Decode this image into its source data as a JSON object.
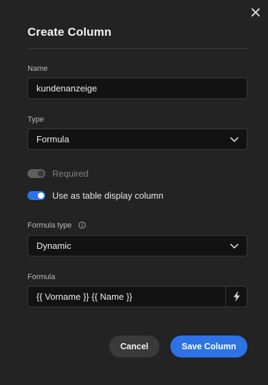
{
  "dialog": {
    "title": "Create Column"
  },
  "name_field": {
    "label": "Name",
    "value": "kundenanzeige"
  },
  "type_field": {
    "label": "Type",
    "value": "Formula"
  },
  "toggles": {
    "required": {
      "label": "Required",
      "on": false
    },
    "display_column": {
      "label": "Use as table display column",
      "on": true
    }
  },
  "formula_type_field": {
    "label": "Formula type",
    "value": "Dynamic"
  },
  "formula_field": {
    "label": "Formula",
    "value": "{{ Vorname }} {{ Name }}"
  },
  "actions": {
    "cancel_label": "Cancel",
    "save_label": "Save Column"
  },
  "colors": {
    "accent": "#2d73e6",
    "background": "#232323",
    "input_background": "#121212"
  },
  "icons": [
    "close-icon",
    "chevron-down-icon",
    "info-icon",
    "lightning-bolt-icon"
  ]
}
